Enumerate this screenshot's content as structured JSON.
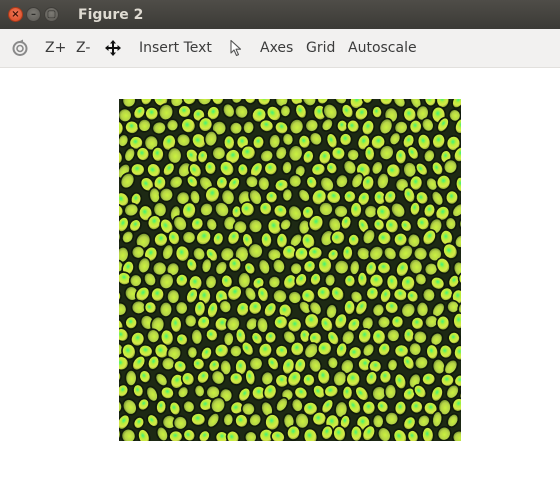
{
  "window": {
    "title": "Figure 2",
    "controls": {
      "close": "×",
      "minimize": "–",
      "maximize": "▢"
    }
  },
  "toolbar": {
    "items": [
      {
        "label": "",
        "icon": "reset-view-icon"
      },
      {
        "label": "Z+"
      },
      {
        "label": "Z-"
      },
      {
        "label": "",
        "icon": "move-icon"
      },
      {
        "label": "Insert Text"
      },
      {
        "label": "",
        "icon": "pointer-icon"
      },
      {
        "label": "Axes"
      },
      {
        "label": "Grid"
      },
      {
        "label": "Autoscale"
      }
    ]
  },
  "figure": {
    "image": "green-yellow cellular texture",
    "colors": {
      "background": "#1f2a16",
      "dark": "#141c0f",
      "mid": "#7fb23a",
      "bright": "#d6f03a",
      "highlight": "#4df070"
    }
  }
}
